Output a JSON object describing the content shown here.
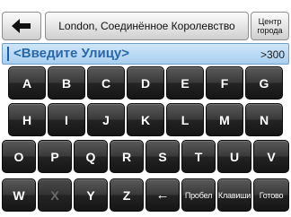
{
  "header": {
    "location_label": "London, Соединённое Королевство",
    "center_label_line1": "Центр",
    "center_label_line2": "города"
  },
  "input": {
    "placeholder": "<Введите Улицу>",
    "match_count": ">300"
  },
  "keyboard": {
    "rows": [
      [
        "A",
        "B",
        "C",
        "D",
        "E",
        "F",
        "G"
      ],
      [
        "H",
        "I",
        "J",
        "K",
        "L",
        "M",
        "N"
      ],
      [
        "O",
        "P",
        "Q",
        "R",
        "S",
        "T",
        "U",
        "V"
      ],
      [
        "W",
        "X",
        "Y",
        "Z",
        "←",
        "Пробел",
        "Клавиши",
        "Готово"
      ]
    ]
  },
  "icons": {
    "back": "back-arrow-icon"
  },
  "colors": {
    "key_face": "#2c2c2c",
    "input_background": "#b3d7f3",
    "input_text": "#2a67a8"
  }
}
